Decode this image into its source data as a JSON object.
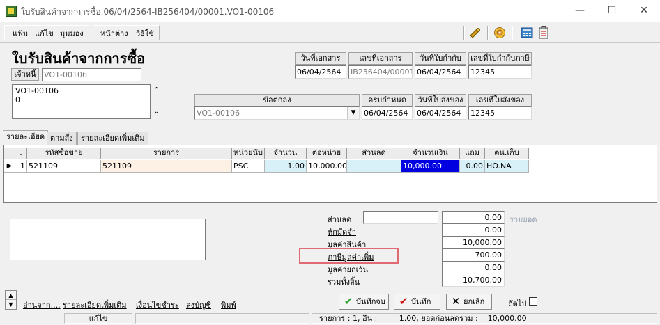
{
  "window": {
    "title": "ใบรับสินค้าจากการซื้อ.06/04/2564-IB256404/00001.VO1-00106",
    "controls": {
      "minimize": "—",
      "maximize": "☐",
      "close": "✕"
    }
  },
  "menu": {
    "file": "แฟ้ม",
    "edit": "แก้ไข",
    "view": "มุมมอง",
    "window": "หน้าต่าง",
    "help": "วิธีใช้"
  },
  "header": {
    "heading": "ใบรับสินค้าจากการซื้อ",
    "creditor_label": "เจ้าหนี้",
    "creditor_code": "VO1-00106",
    "creditor_info": [
      "VO1-00106",
      "0"
    ],
    "doc_date_label": "วันที่เอกสาร",
    "doc_date": "06/04/2564",
    "doc_no_label": "เลขที่เอกสาร",
    "doc_no": "IB256404/00001",
    "tax_inv_date_label": "วันที่ใบกำกับ",
    "tax_inv_date": "06/04/2564",
    "tax_inv_no_label": "เลขที่ใบกำกับภาษี",
    "tax_inv_no": "12345",
    "agreement_label": "ข้อตกลง",
    "agreement_value": "VO1-00106",
    "due_label": "ครบกำหนด",
    "due_date": "06/04/2564",
    "delivery_date_label": "วันที่ใบส่งของ",
    "delivery_date": "06/04/2564",
    "delivery_no_label": "เลขที่ใบส่งของ",
    "delivery_no": "12345"
  },
  "tabs": [
    "รายละเอียด",
    "ตามสั่ง",
    "รายละเอียดเพิ่มเติม"
  ],
  "grid": {
    "columns": [
      ".",
      "รหัสซื้อขาย",
      "รายการ",
      "หน่วยนับ",
      "จำนวน",
      "ต่อหน่วย",
      "ส่วนลด",
      "จำนวนเงิน",
      "แถม",
      "ตน.เก็บ"
    ],
    "rows": [
      {
        "no": "1",
        "code": "521109",
        "name": "521109",
        "unit": "PSC",
        "qty": "1.00",
        "price": "10,000.00",
        "discount": "",
        "amount": "10,000.00",
        "free": "0.00",
        "location": "HO.NA"
      }
    ]
  },
  "summary": {
    "discount_label": "ส่วนลด",
    "discount_input": "",
    "discount_value": "0.00",
    "total_link": "รวมยอด",
    "deposit_label": "หักมัดจำ",
    "deposit_value": "0.00",
    "goods_label": "มูลค่าสินค้า",
    "goods_value": "10,000.00",
    "vat_label": "ภาษีมูลค่าเพิ่ม",
    "vat_value": "700.00",
    "exempt_label": "มูลค่ายกเว้น",
    "exempt_value": "0.00",
    "grand_label": "รวมทั้งสิ้น",
    "grand_value": "10,700.00"
  },
  "bottom_links": [
    "อ่านจาก....",
    "รายละเอียดเพิ่มเติม",
    "เงื่อนไขชำระ",
    "ลงบัญชี",
    "พิมพ์"
  ],
  "buttons": {
    "save_close": "บันทึกจบ",
    "save": "บันทึก",
    "cancel": "ยกเลิก",
    "next_label": "ถัดไป"
  },
  "status": {
    "mode": "แก้ไข",
    "info": "รายการ : 1, อื่น :         1.00, ยอดก่อนลดรวม :    10,000.00"
  },
  "colors": {
    "highlight_box": "#e06a74",
    "selected_cell": "#0000e0",
    "qty_cell": "#d8f0f8",
    "name_cell": "#fdf0e4"
  }
}
